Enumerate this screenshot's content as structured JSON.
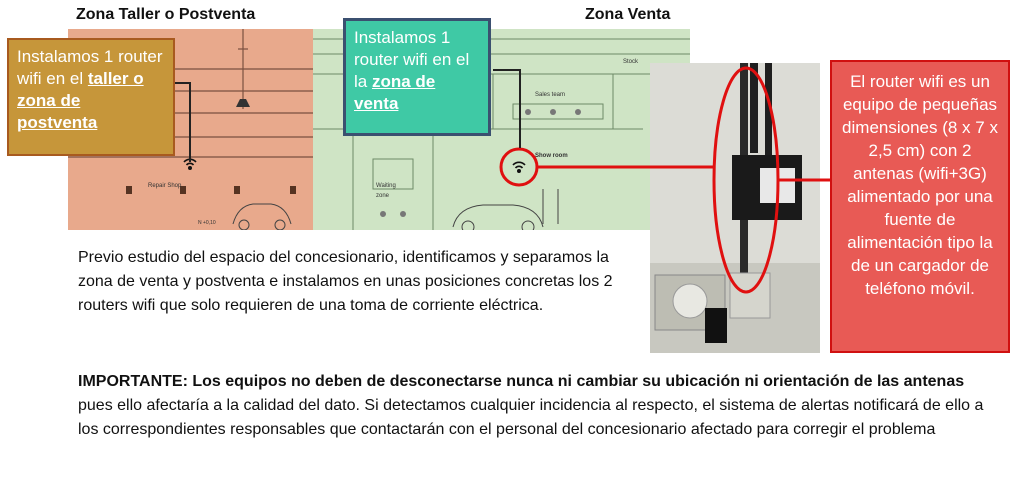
{
  "zones": {
    "left_title": "Zona Taller o Postventa",
    "right_title": "Zona Venta"
  },
  "floor_plan": {
    "repair_shop": "Repair Shop",
    "sales_team": "Sales team",
    "show_room": "Show room",
    "waiting_zone_1": "Waiting",
    "waiting_zone_2": "zone",
    "stock": "Stock",
    "level": "N +0,10"
  },
  "callouts": {
    "taller_prefix": "Instalamos 1 router wifi en el ",
    "taller_bold": "taller o zona de postventa",
    "venta_prefix": "Instalamos 1 router wifi en el la ",
    "venta_bold": "zona de venta",
    "router_info": "El router wifi es un equipo de pequeñas dimensiones (8 x 7 x 2,5 cm) con 2 antenas (wifi+3G) alimentado por una fuente de alimentación tipo la de un cargador de teléfono móvil."
  },
  "description": "Previo estudio del espacio del concesionario, identificamos y separamos la zona de venta y postventa e instalamos en unas posiciones concretas los 2 routers wifi que solo requieren de una toma de corriente eléctrica.",
  "important": {
    "bold_part": "IMPORTANTE: Los equipos no deben de desconectarse nunca ni cambiar su ubicación ni orientación de las antenas",
    "rest": " pues ello afectaría a la calidad del dato. Si detectamos cualquier incidencia al respecto, el sistema de alertas notificará de ello a los correspondientes responsables que contactarán con el personal del concesionario afectado para corregir el problema"
  },
  "colors": {
    "taller_zone": "#e8a98c",
    "venta_zone": "#cfe4c5",
    "highlight_red": "#e01010"
  }
}
